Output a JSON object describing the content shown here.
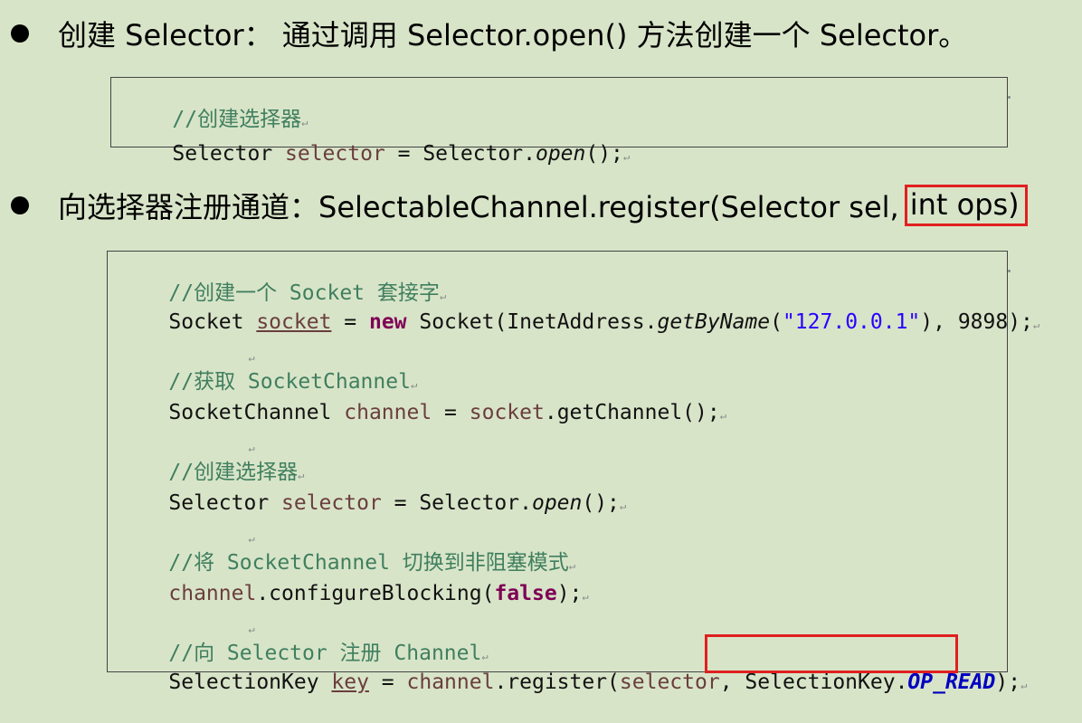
{
  "bullet1": {
    "text": "创建 Selector： 通过调用 Selector.open() 方法创建一个 Selector。"
  },
  "code1": {
    "comment": "//创建选择器",
    "line": {
      "type": "Selector ",
      "var": "selector",
      "mid": " = Selector.",
      "method": "open",
      "end": "();"
    }
  },
  "bullet2": {
    "text": "向选择器注册通道：SelectableChannel.register(Selector sel,",
    "highlighted": "int ops)"
  },
  "code2": {
    "c1": "//创建一个 Socket 套接字",
    "l1": {
      "p1": "Socket ",
      "var": "socket",
      "p2": " = ",
      "kw": "new",
      "p3": " Socket(InetAddress.",
      "method": "getByName",
      "p4": "(",
      "str": "\"127.0.0.1\"",
      "p5": "), 9898);"
    },
    "c2": "//获取 SocketChannel",
    "l2": {
      "p1": "SocketChannel ",
      "var": "channel",
      "p2": " = ",
      "var2": "socket",
      "p3": ".getChannel();"
    },
    "c3": "//创建选择器",
    "l3": {
      "p1": "Selector ",
      "var": "selector",
      "p2": " = Selector.",
      "method": "open",
      "p3": "();"
    },
    "c4": "//将 SocketChannel 切换到非阻塞模式",
    "l4": {
      "var": "channel",
      "p1": ".configureBlocking(",
      "kw": "false",
      "p2": ");"
    },
    "c5": "//向 Selector 注册 Channel",
    "l5": {
      "p1": "SelectionKey ",
      "var": "key",
      "p2": " = ",
      "var2": "channel",
      "p3": ".register(",
      "var3": "selector",
      "p4": ", ",
      "p5": "SelectionKey.",
      "const": "OP_READ",
      "p6": ");"
    },
    "para_mark": "↵"
  }
}
